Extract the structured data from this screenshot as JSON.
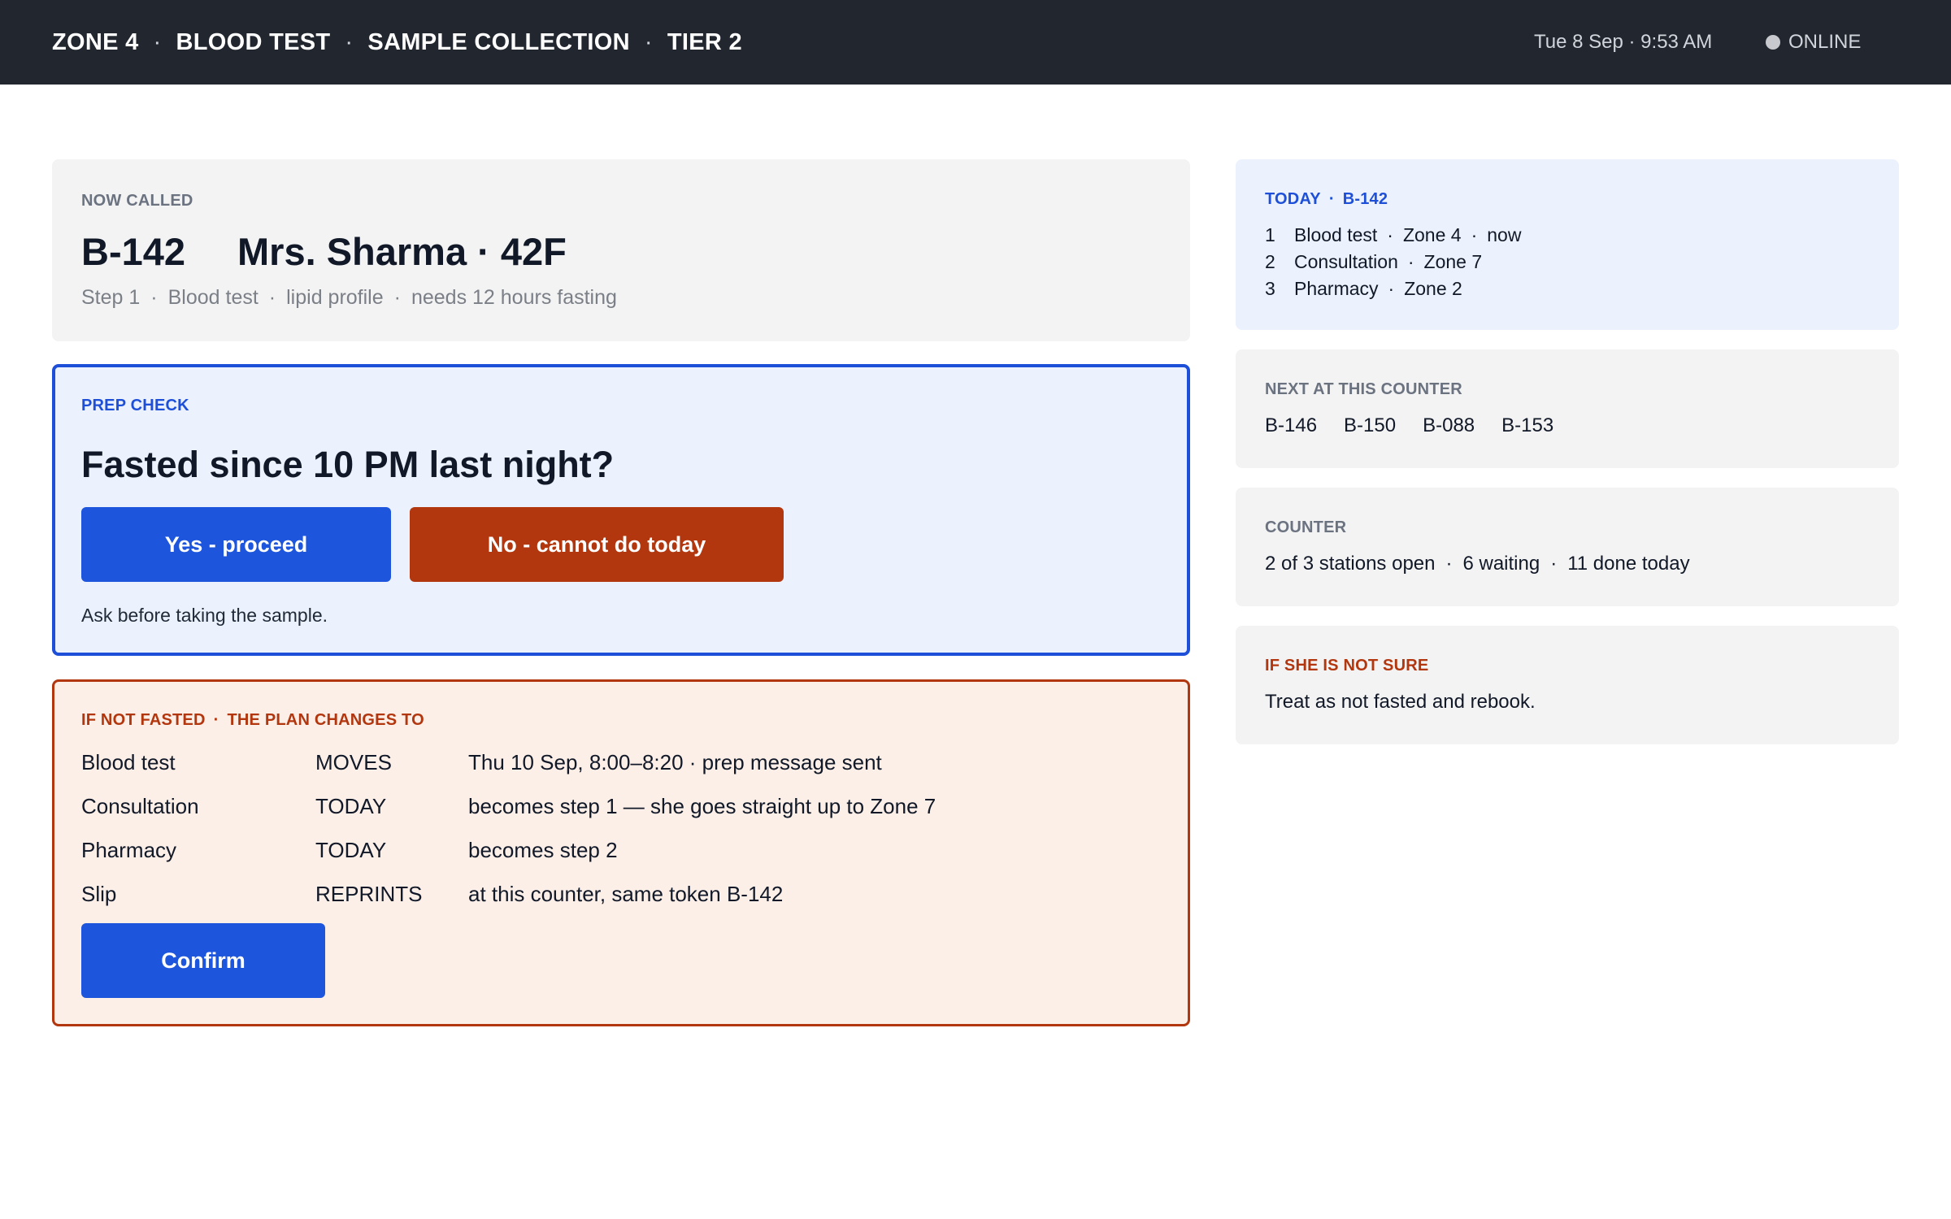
{
  "header": {
    "breadcrumbs": [
      "ZONE 4",
      "BLOOD TEST",
      "SAMPLE COLLECTION",
      "TIER 2"
    ],
    "separator": "·",
    "datetime": "Tue 8 Sep · 9:53 AM",
    "status": "ONLINE"
  },
  "now_called": {
    "label": "NOW CALLED",
    "token": "B-142",
    "patient": "Mrs. Sharma · 42F",
    "details": [
      "Step 1",
      "Blood test",
      "lipid profile",
      "needs 12 hours fasting"
    ]
  },
  "prep_check": {
    "label": "PREP CHECK",
    "question": "Fasted since 10 PM last night?",
    "yes_label": "Yes - proceed",
    "no_label": "No - cannot do today",
    "hint": "Ask before taking the sample."
  },
  "plan": {
    "label_a": "IF NOT FASTED",
    "label_b": "THE PLAN CHANGES TO",
    "rows": [
      {
        "item": "Blood test",
        "status": "MOVES",
        "detail": "Thu 10 Sep, 8:00–8:20 · prep message sent"
      },
      {
        "item": "Consultation",
        "status": "TODAY",
        "detail": "becomes step 1 — she goes straight up to Zone 7"
      },
      {
        "item": "Pharmacy",
        "status": "TODAY",
        "detail": "becomes step 2"
      },
      {
        "item": "Slip",
        "status": "REPRINTS",
        "detail": "at this counter, same token B-142"
      }
    ],
    "confirm_label": "Confirm"
  },
  "today": {
    "label_a": "TODAY",
    "label_b": "B-142",
    "items": [
      {
        "n": "1",
        "parts": [
          "Blood test",
          "Zone 4",
          "now"
        ]
      },
      {
        "n": "2",
        "parts": [
          "Consultation",
          "Zone 7"
        ]
      },
      {
        "n": "3",
        "parts": [
          "Pharmacy",
          "Zone 2"
        ]
      }
    ]
  },
  "next_counter": {
    "label": "NEXT AT THIS COUNTER",
    "tokens": [
      "B-146",
      "B-150",
      "B-088",
      "B-153"
    ]
  },
  "counter": {
    "label": "COUNTER",
    "stats": [
      "2 of 3 stations open",
      "6 waiting",
      "11 done today"
    ]
  },
  "unsure": {
    "label": "IF SHE IS NOT SURE",
    "text": "Treat as not fasted and rebook."
  },
  "colors": {
    "topbar": "#22262f",
    "primary": "#1d56dc",
    "danger": "#b2360e",
    "info_bg": "#ebf2fd",
    "warn_bg": "#fcefe8",
    "panel_bg": "#f3f3f3"
  },
  "icons": {
    "status": "status-dot-icon"
  }
}
